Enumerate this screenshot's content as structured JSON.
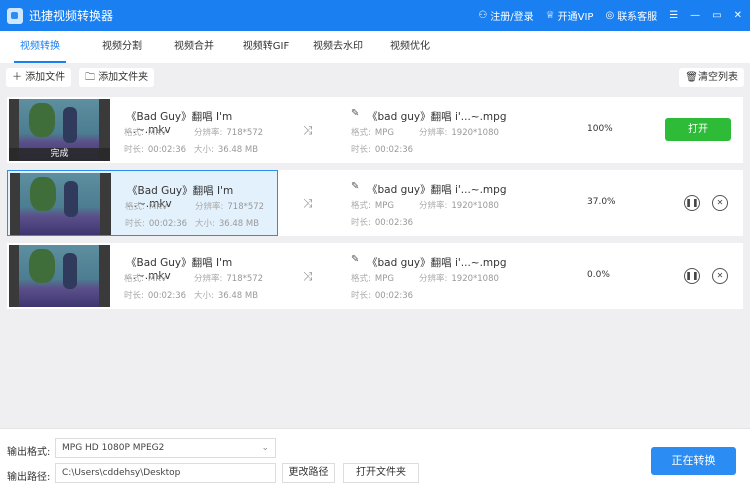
{
  "app": {
    "title": "迅捷视频转换器",
    "login": "注册/登录",
    "vip": "开通VIP",
    "support": "联系客服"
  },
  "tabs": [
    "视频转换",
    "视频分割",
    "视频合并",
    "视频转GIF",
    "视频去水印",
    "视频优化"
  ],
  "toolbar": {
    "add_file": "添加文件",
    "add_folder": "添加文件夹",
    "clear": "清空列表"
  },
  "labels": {
    "format": "格式:",
    "resolution": "分辨率:",
    "duration": "时长:",
    "size": "大小:",
    "done": "完成"
  },
  "rows": [
    {
      "src_name": "《Bad Guy》翻唱 I'm ...~.mkv",
      "src_format": "MKV",
      "src_res": "718*572",
      "src_dur": "00:02:36",
      "src_size": "36.48 MB",
      "dst_name": "《bad guy》翻唱 i'...~.mpg",
      "dst_format": "MPG",
      "dst_res": "1920*1080",
      "dst_dur": "00:02:36",
      "progress": "100%",
      "action": "打开"
    },
    {
      "src_name": "《Bad Guy》翻唱 I'm ...~.mkv",
      "src_format": "MKV",
      "src_res": "718*572",
      "src_dur": "00:02:36",
      "src_size": "36.48 MB",
      "dst_name": "《bad guy》翻唱 i'...~.mpg",
      "dst_format": "MPG",
      "dst_res": "1920*1080",
      "dst_dur": "00:02:36",
      "progress": "37.0%"
    },
    {
      "src_name": "《Bad Guy》翻唱 I'm ...~.mkv",
      "src_format": "MKV",
      "src_res": "718*572",
      "src_dur": "00:02:36",
      "src_size": "36.48 MB",
      "dst_name": "《bad guy》翻唱 i'...~.mpg",
      "dst_format": "MPG",
      "dst_res": "1920*1080",
      "dst_dur": "00:02:36",
      "progress": "0.0%"
    }
  ],
  "bottom": {
    "format_label": "输出格式:",
    "format_value": "MPG  HD 1080P MPEG2",
    "path_label": "输出路径:",
    "path_value": "C:\\Users\\cddehsy\\Desktop",
    "change_path": "更改路径",
    "open_folder": "打开文件夹",
    "convert": "正在转换"
  },
  "colors": {
    "brand": "#1a7ff0",
    "open": "#2dbb38"
  }
}
